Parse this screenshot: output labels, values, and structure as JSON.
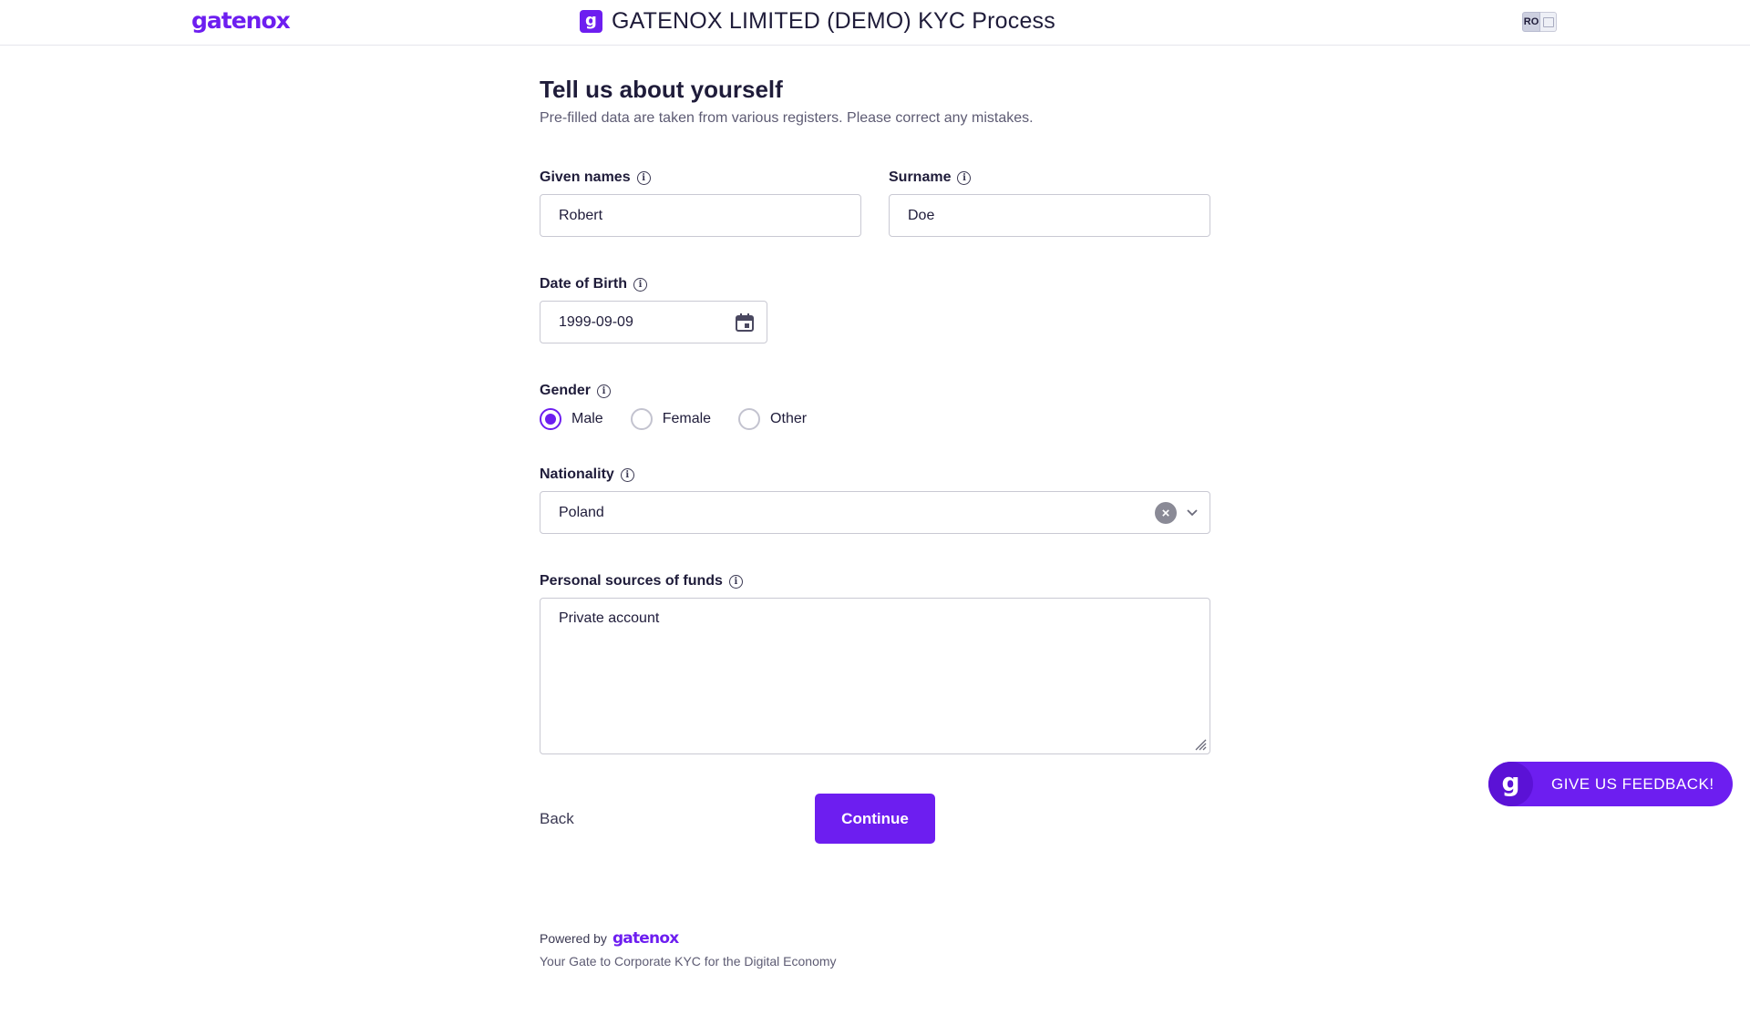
{
  "header": {
    "logo_text": "gatenox",
    "logo_mark": "g",
    "title": "GATENOX LIMITED (DEMO) KYC Process",
    "lang_badge": "RO"
  },
  "form": {
    "title": "Tell us about yourself",
    "subtitle": "Pre-filled data are taken from various registers. Please correct any mistakes.",
    "given_names": {
      "label": "Given names",
      "value": "Robert"
    },
    "surname": {
      "label": "Surname",
      "value": "Doe"
    },
    "date_of_birth": {
      "label": "Date of Birth",
      "value": "1999-09-09"
    },
    "gender": {
      "label": "Gender",
      "options": [
        "Male",
        "Female",
        "Other"
      ],
      "selected": "Male"
    },
    "nationality": {
      "label": "Nationality",
      "value": "Poland"
    },
    "sources_of_funds": {
      "label": "Personal sources of funds",
      "value": "Private account"
    },
    "back_label": "Back",
    "continue_label": "Continue"
  },
  "footer": {
    "powered_by": "Powered by",
    "logo_text": "gatenox",
    "tagline": "Your Gate to Corporate KYC for the Digital Economy"
  },
  "feedback": {
    "mark": "g",
    "label": "GIVE US FEEDBACK!"
  },
  "icons": {
    "info": "info-icon",
    "calendar": "calendar-icon",
    "clear": "clear-icon",
    "chevron": "chevron-down-icon"
  },
  "colors": {
    "brand": "#6d1ef0",
    "text": "#1f1c3a",
    "muted": "#5d5b73",
    "border": "#c9c9d3"
  }
}
